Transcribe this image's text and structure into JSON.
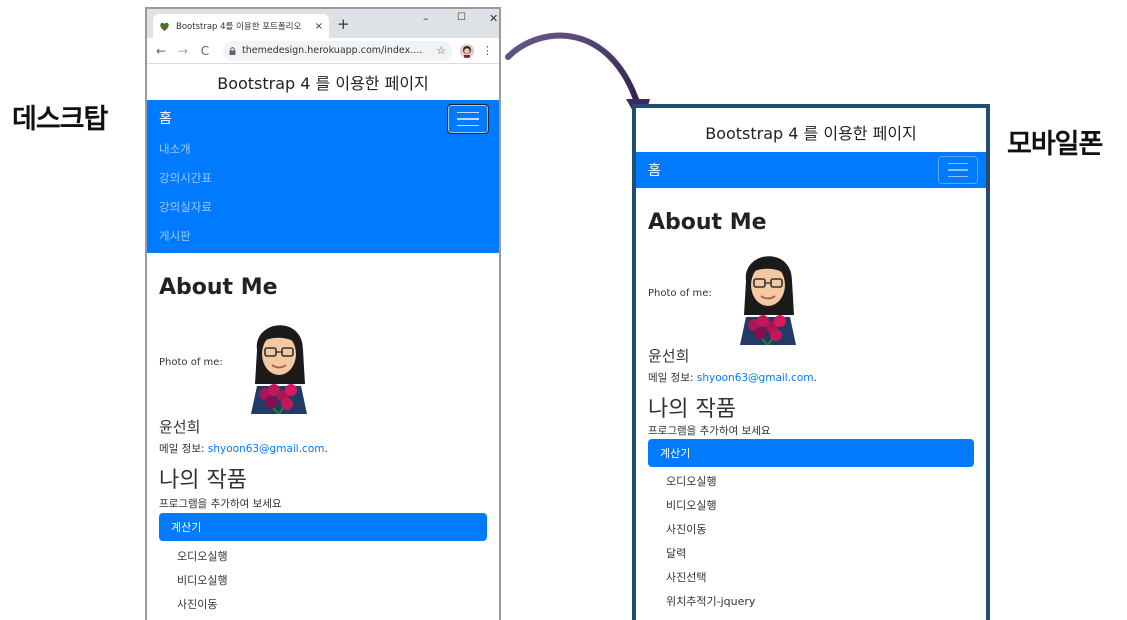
{
  "labels": {
    "desktop": "데스크탑",
    "mobile": "모바일폰"
  },
  "browser": {
    "tab_title": "Bootstrap 4를 이용한 포트폴리오",
    "tab_close": "×",
    "new_tab": "+",
    "win_min": "–",
    "win_max": "☐",
    "win_close": "✕",
    "back": "←",
    "forward": "→",
    "reload": "C",
    "url": "themedesign.herokuapp.com/index....",
    "star": "☆",
    "menu": "⋮"
  },
  "page": {
    "header_title": "Bootstrap 4 를 이용한 페이지",
    "nav_brand": "홈",
    "nav_items": [
      "내소개",
      "강의시간표",
      "강의실자료",
      "게시판"
    ],
    "about_title": "About Me",
    "photo_label": "Photo of me:",
    "name": "윤선희",
    "mail_label": "메일 정보: ",
    "mail_address": "shyoon63@gmail.com",
    "mail_suffix": ".",
    "works_title": "나의 작품",
    "works_subtitle": "프로그램을 추가하여 보세요",
    "works_active": "계산기",
    "works_items": [
      "오디오실행",
      "비디오실행",
      "사진이동",
      "달력",
      "사진선택",
      "위치추적기-jquery"
    ]
  },
  "colors": {
    "primary": "#007bff",
    "phone_border": "#1f4e6e",
    "arrow": "#3b2a5e"
  },
  "icons": {
    "favicon": "leaf-heart-icon",
    "lock": "lock-icon",
    "hamburger": "hamburger-menu-icon",
    "avatar": "bitmoji-avatar-icon",
    "arrow": "curved-arrow-icon"
  }
}
